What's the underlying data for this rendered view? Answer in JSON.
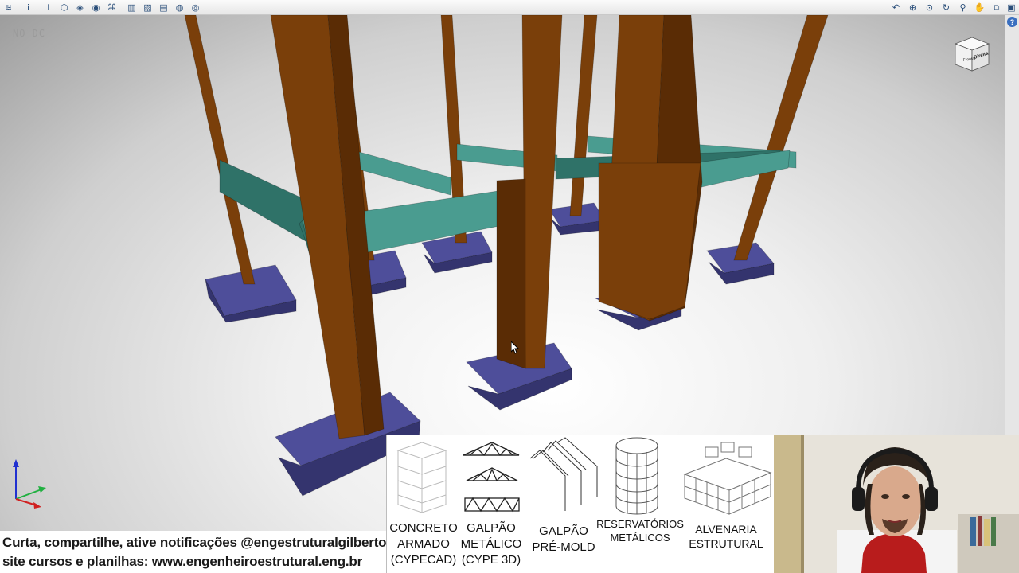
{
  "toolbar": {
    "left_icons": [
      {
        "name": "layers-icon",
        "glyph": "≋"
      },
      {
        "name": "info-icon",
        "glyph": "i"
      },
      {
        "name": "axes-icon",
        "glyph": "⊥"
      },
      {
        "name": "cube-view-icon",
        "glyph": "⬡"
      },
      {
        "name": "box-icon",
        "glyph": "◈"
      },
      {
        "name": "shading-icon",
        "glyph": "◉"
      },
      {
        "name": "mesh-icon",
        "glyph": "⌘"
      },
      {
        "name": "book-icon",
        "glyph": "▥"
      },
      {
        "name": "graph-icon",
        "glyph": "▨"
      },
      {
        "name": "window-icon",
        "glyph": "▤"
      },
      {
        "name": "globe-icon",
        "glyph": "◍"
      },
      {
        "name": "eye-icon",
        "glyph": "◎"
      }
    ],
    "right_icons": [
      {
        "name": "zoom-previous-icon",
        "glyph": "↶"
      },
      {
        "name": "zoom-window-icon",
        "glyph": "⊕"
      },
      {
        "name": "zoom-all-icon",
        "glyph": "⊙"
      },
      {
        "name": "rotate-icon",
        "glyph": "↻"
      },
      {
        "name": "zoom-icon",
        "glyph": "⚲"
      },
      {
        "name": "pan-hand-icon",
        "glyph": "✋"
      },
      {
        "name": "fit-window-icon",
        "glyph": "⧉"
      },
      {
        "name": "save-icon",
        "glyph": "▣"
      }
    ],
    "colors": {
      "icon": "#2b4f7a"
    }
  },
  "viewport": {
    "view_mode": "NO DC",
    "colors": {
      "column": "#7a3f0a",
      "column_dark": "#5a2c05",
      "beam": "#4a9c90",
      "beam_dark": "#2f7268",
      "footing": "#4e4e9a",
      "footing_dark": "#34346e"
    },
    "nav_cube": {
      "face_left": "Frontal",
      "face_right": "Direita"
    },
    "help_glyph": "?"
  },
  "caption": {
    "line1": "Curta, compartilhe, ative notificações @engestruturalgilberto",
    "line2": "site cursos e planilhas: www.engenheiroestrutural.eng.br"
  },
  "banner": {
    "courses": [
      {
        "lines": [
          "CONCRETO",
          "ARMADO",
          "(CYPECAD)"
        ],
        "icon": "building-frame-icon"
      },
      {
        "lines": [
          "GALPÃO",
          "METÁLICO",
          "(CYPE 3D)"
        ],
        "icon": "truss-icon"
      },
      {
        "lines": [
          "GALPÃO",
          "PRÉ-MOLD"
        ],
        "icon": "precast-panel-icon"
      },
      {
        "lines": [
          "RESERVATÓRIOS",
          "METÁLICOS"
        ],
        "icon": "tank-icon"
      },
      {
        "lines": [
          "ALVENARIA",
          "ESTRUTURAL"
        ],
        "icon": "masonry-block-icon"
      }
    ]
  }
}
